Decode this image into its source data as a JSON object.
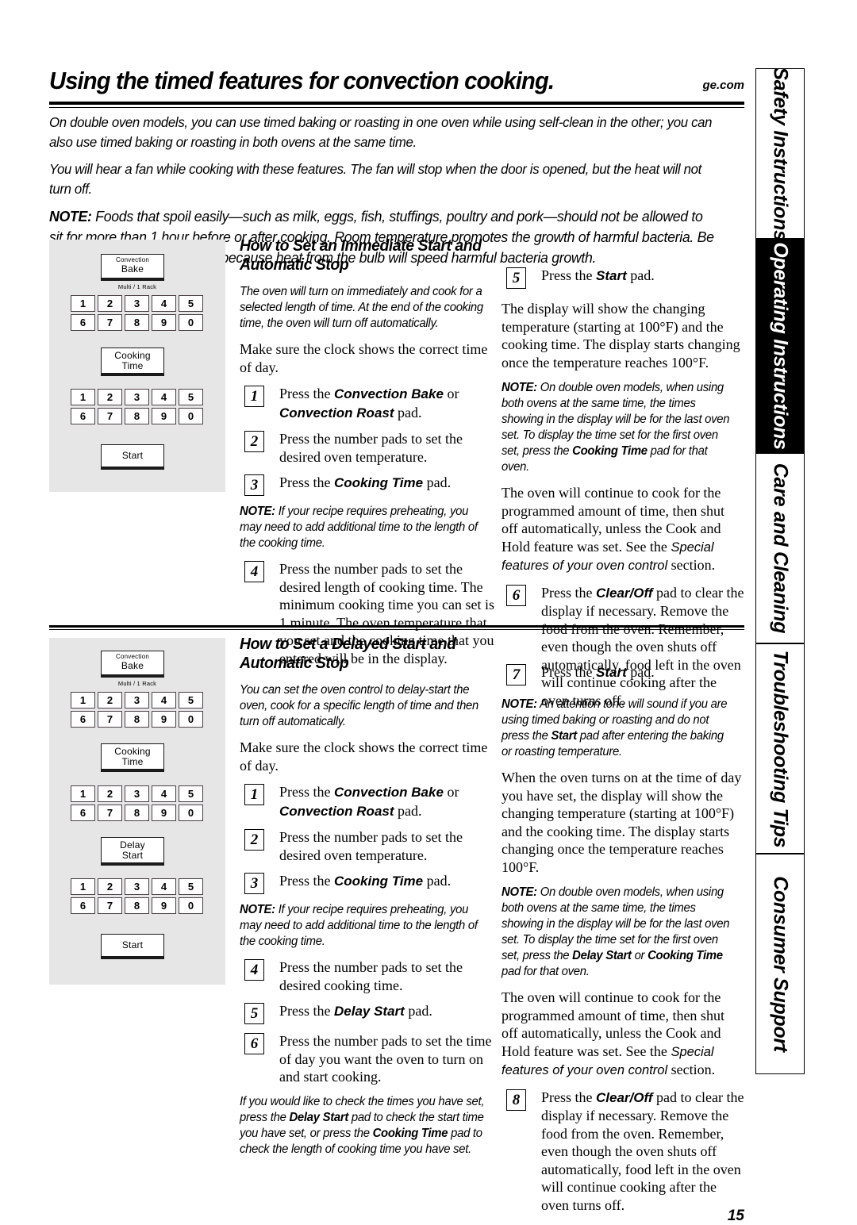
{
  "header": {
    "title": "Using the timed features for convection cooking.",
    "site": "ge.com"
  },
  "intro": [
    "On double oven models, you can use timed baking or roasting in one oven while using self-clean in the other; you can also use timed baking or roasting in both ovens at the same time.",
    "You will hear a fan while cooking with these features. The fan will stop when the door is opened, but the heat will not turn off."
  ],
  "intro_note": {
    "label": "NOTE:",
    "text": "Foods that spoil easily—such as milk, eggs, fish, stuffings, poultry and pork—should not be allowed to sit for more than 1 hour before or after cooking. Room temperature promotes the growth of harmful bacteria. Be sure that the oven light is off because heat from the bulb will speed harmful bacteria growth."
  },
  "sidebar": {
    "tabs": [
      {
        "label": "Safety Instructions",
        "active": false
      },
      {
        "label": "Operating Instructions",
        "active": true
      },
      {
        "label": "Care and Cleaning",
        "active": false
      },
      {
        "label": "Troubleshooting Tips",
        "active": false
      },
      {
        "label": "Consumer Support",
        "active": false
      }
    ]
  },
  "keypad": {
    "row1": [
      "1",
      "2",
      "3",
      "4",
      "5"
    ],
    "row2": [
      "6",
      "7",
      "8",
      "9",
      "0"
    ]
  },
  "diagram1": {
    "convection_bake_l1": "Convection",
    "convection_bake_l2": "Bake",
    "multi_rack": "Multi / 1 Rack",
    "cooking_time_l1": "Cooking",
    "cooking_time_l2": "Time",
    "start": "Start"
  },
  "diagram2": {
    "convection_bake_l1": "Convection",
    "convection_bake_l2": "Bake",
    "multi_rack": "Multi / 1 Rack",
    "cooking_time_l1": "Cooking",
    "cooking_time_l2": "Time",
    "delay_start_l1": "Delay",
    "delay_start_l2": "Start",
    "start": "Start"
  },
  "section1": {
    "heading": "How to Set an Immediate Start and Automatic Stop",
    "lead_note": "The oven will turn on immediately and cook for a selected length of time. At the end of the cooking time, the oven will turn off automatically.",
    "clock_line": "Make sure the clock shows the correct time of day.",
    "step1": {
      "num": "1",
      "pre": "Press the ",
      "b1": "Convection Bake",
      "mid": " or ",
      "b2": "Convection Roast",
      "post": " pad."
    },
    "step2": {
      "num": "2",
      "text": "Press the number pads to set the desired oven temperature."
    },
    "step3": {
      "num": "3",
      "pre": "Press the ",
      "b1": "Cooking Time",
      "post": " pad."
    },
    "note_preheat": {
      "label": "NOTE:",
      "text": "If your recipe requires preheating, you may need to add additional time to the length of the cooking time."
    },
    "step4": {
      "num": "4",
      "text": "Press the number pads to set the desired length of cooking time. The minimum cooking time you can set is 1 minute. The oven temperature that you set and the cooking time that you entered will be in the display."
    },
    "step5": {
      "num": "5",
      "pre": "Press the ",
      "b1": "Start",
      "post": " pad."
    },
    "display_para": "The display will show the changing temperature (starting at 100°F) and the cooking time. The display starts changing once the temperature reaches 100°F.",
    "note_double": {
      "label": "NOTE:",
      "t1": "On double oven models, when using both ovens at the same time, the times showing in the display will be for the last oven set. To display the time set for the first oven set, press the ",
      "b1": "Cooking Time",
      "t2": " pad for that oven."
    },
    "continue_para": {
      "t1": "The oven will continue to cook for the programmed amount of time, then shut off automatically, unless the Cook and Hold feature was set. See the ",
      "i1": "Special features of your oven control",
      "t2": " section."
    },
    "step6": {
      "num": "6",
      "pre": "Press the ",
      "b1": "Clear/Off",
      "post": " pad to clear the display if necessary. Remove the food from the oven. Remember, even though the oven shuts off automatically, food left in the oven will continue cooking after the oven turns off."
    }
  },
  "section2": {
    "heading": "How to Set a Delayed Start and Automatic Stop",
    "lead_note": "You can set the oven control to delay-start the oven, cook for a specific length of time and then turn off automatically.",
    "clock_line": "Make sure the clock shows the correct time of day.",
    "step1": {
      "num": "1",
      "pre": "Press the ",
      "b1": "Convection Bake",
      "mid": " or ",
      "b2": "Convection Roast",
      "post": " pad."
    },
    "step2": {
      "num": "2",
      "text": "Press the number pads to set the desired oven temperature."
    },
    "step3": {
      "num": "3",
      "pre": "Press the ",
      "b1": "Cooking Time",
      "post": " pad."
    },
    "note_preheat": {
      "label": "NOTE:",
      "text": "If your recipe requires preheating, you may need to add additional time to the length of the cooking time."
    },
    "step4": {
      "num": "4",
      "text": "Press the number pads to set the desired cooking time."
    },
    "step5": {
      "num": "5",
      "pre": "Press the ",
      "b1": "Delay Start",
      "post": " pad."
    },
    "step6": {
      "num": "6",
      "text": "Press the number pads to set the time of day you want the oven to turn on and start cooking."
    },
    "check_note": {
      "t1": "If you would like to check the times you have set, press the ",
      "b1": "Delay Start",
      "t2": " pad to check the start time you have set, or press the ",
      "b2": "Cooking Time",
      "t3": " pad to check the length of cooking time you have set."
    },
    "step7": {
      "num": "7",
      "pre": "Press the ",
      "b1": "Start",
      "post": " pad."
    },
    "note_tone": {
      "label": "NOTE:",
      "t1": "An attention tone will sound if you are using timed baking or roasting and do not press the ",
      "b1": "Start",
      "t2": " pad after entering the baking or roasting temperature."
    },
    "turns_on_para": "When the oven turns on at the time of day you have set, the display will show the changing temperature (starting at 100°F) and the cooking time. The display starts changing once the temperature reaches 100°F.",
    "note_double": {
      "label": "NOTE:",
      "t1": "On double oven models, when using both ovens at the same time, the times showing in the display will be for the last oven set. To display the time set for the first oven set, press the ",
      "b1": "Delay Start",
      "t2": " or ",
      "b2": "Cooking Time",
      "t3": " pad for that oven."
    },
    "continue_para": {
      "t1": "The oven will continue to cook for the programmed amount of time, then shut off automatically, unless the Cook and Hold feature was set. See the ",
      "i1": "Special features of your oven control",
      "t2": " section."
    },
    "step8": {
      "num": "8",
      "pre": "Press the ",
      "b1": "Clear/Off",
      "post": " pad to clear the display if necessary. Remove the food from the oven. Remember, even though the oven shuts off automatically, food left in the oven will continue cooking after the oven turns off."
    }
  },
  "page_number": "15"
}
